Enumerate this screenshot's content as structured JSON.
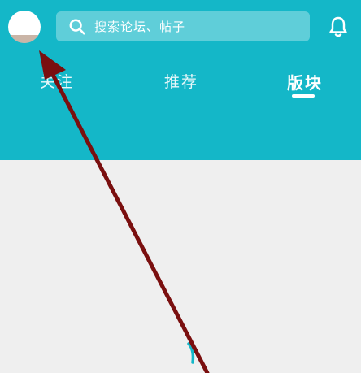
{
  "colors": {
    "header_bg": "#14b7c8",
    "content_bg": "#efefef",
    "annotation_arrow": "#7a0f0f"
  },
  "avatar": {
    "icon": "avatar"
  },
  "search": {
    "icon": "search-icon",
    "placeholder": "搜索论坛、帖子"
  },
  "notifications": {
    "icon": "bell-icon"
  },
  "tabs": [
    {
      "label": "关注",
      "active": false
    },
    {
      "label": "推荐",
      "active": false
    },
    {
      "label": "版块",
      "active": true
    }
  ],
  "content": {
    "loading": true
  },
  "annotation": {
    "type": "arrow",
    "points_to": "avatar"
  }
}
